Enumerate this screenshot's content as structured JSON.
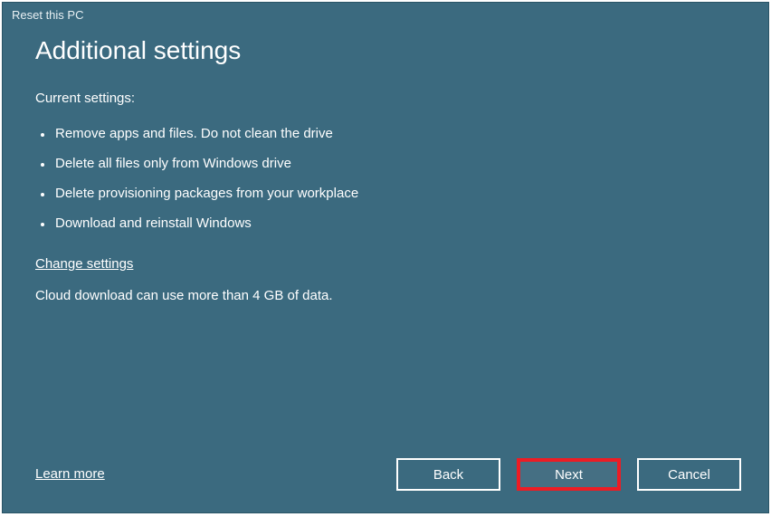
{
  "window": {
    "title": "Reset this PC"
  },
  "page": {
    "title": "Additional settings",
    "subheader": "Current settings:",
    "settings": [
      "Remove apps and files. Do not clean the drive",
      "Delete all files only from Windows drive",
      "Delete provisioning packages from your workplace",
      "Download and reinstall Windows"
    ],
    "change_link": "Change settings",
    "notice": "Cloud download can use more than 4 GB of data."
  },
  "footer": {
    "learn_more": "Learn more",
    "buttons": {
      "back": "Back",
      "next": "Next",
      "cancel": "Cancel"
    }
  }
}
